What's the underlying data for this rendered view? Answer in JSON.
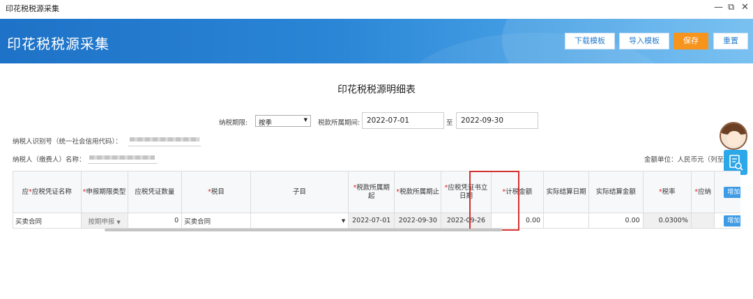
{
  "window": {
    "title": "印花税税源采集",
    "minimize": "—",
    "restore": "⧉",
    "close": "✕"
  },
  "header": {
    "title": "印花税税源采集",
    "buttons": {
      "download": "下载模板",
      "import": "导入模板",
      "save": "保存",
      "reset": "重置"
    }
  },
  "page_title": "印花税税源明细表",
  "form": {
    "period_label": "纳税期限:",
    "period_value": "按季",
    "belong_label": "税款所属期间:",
    "start_date": "2022-07-01",
    "to_label": "至",
    "end_date": "2022-09-30",
    "taxpayer_id_label": "纳税人识别号（统一社会信用代码）：",
    "taxpayer_name_label": "纳税人（缴费人）名称：",
    "unit_label": "金额单位：人民币元（列至"
  },
  "table": {
    "headers": [
      "*应税凭证名称",
      "*申报期限类型",
      "应税凭证数量",
      "*税目",
      "子目",
      "*税款所属期起",
      "*税款所属期止",
      "*应税凭证书立日期",
      "*计税金额",
      "实际结算日期",
      "实际结算金额",
      "*税率",
      "*应纳"
    ],
    "required": [
      true,
      true,
      false,
      true,
      false,
      true,
      true,
      true,
      true,
      false,
      false,
      true,
      true
    ],
    "add_label": "增加",
    "row": {
      "name": "买卖合同",
      "period_type": "按期申报",
      "quantity": "0",
      "item": "买卖合同",
      "subitem": "",
      "start": "2022-07-01",
      "end": "2022-09-30",
      "sign_date": "2022-09-26",
      "amount": "0.00",
      "settle_date": "",
      "settle_amount": "0.00",
      "rate": "0.0300%",
      "due": ""
    }
  },
  "colors": {
    "accent": "#2b86d6",
    "primary_button": "#f7941d",
    "highlight": "#d43030",
    "add_button": "#3e9be6"
  },
  "icons": {
    "avatar": "assistant-avatar-icon",
    "side": "document-search-icon"
  }
}
